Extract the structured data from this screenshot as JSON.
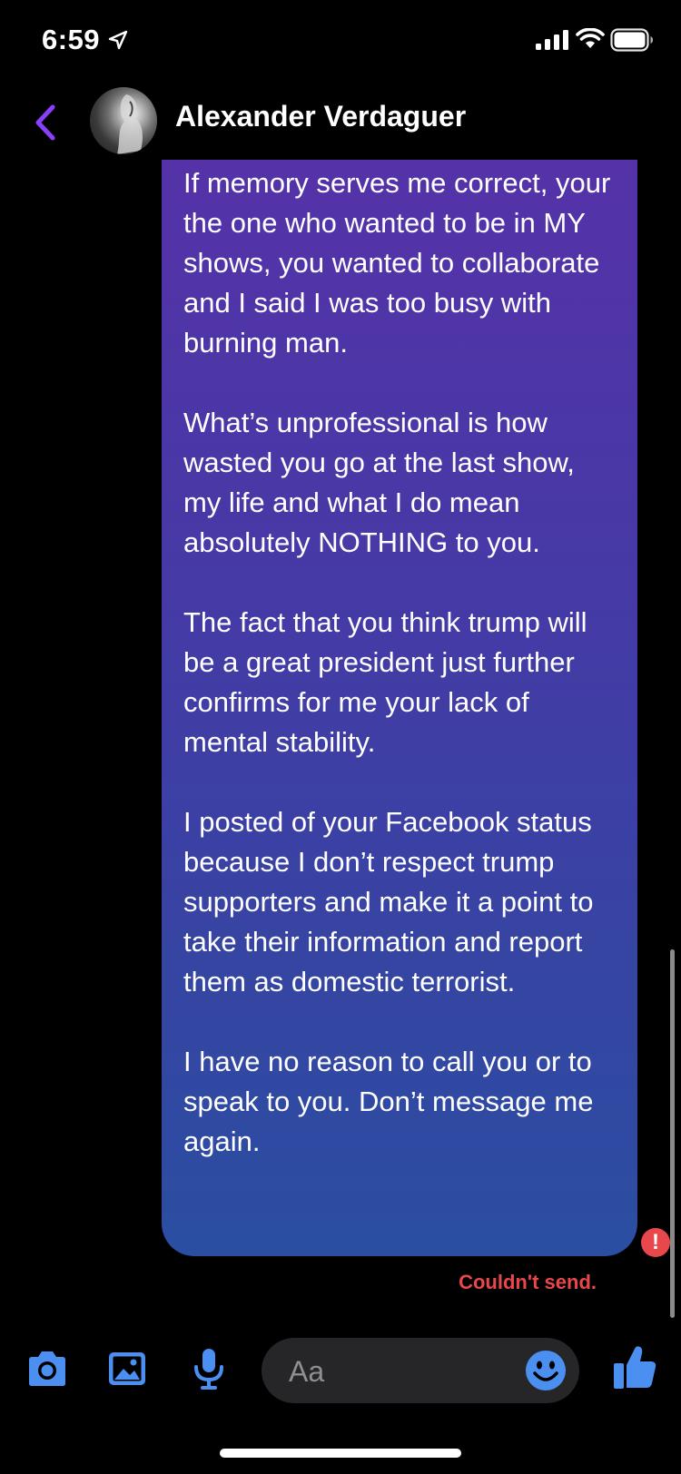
{
  "status_bar": {
    "time": "6:59",
    "icons": [
      "location-arrow-icon",
      "cellular-signal-icon",
      "wifi-icon",
      "battery-icon"
    ]
  },
  "header": {
    "contact_name": "Alexander Verdaguer",
    "back_icon": "chevron-left-icon"
  },
  "message": {
    "paragraphs": [
      "If memory serves me correct, your the one who wanted to be in MY shows, you wanted to collaborate and I said I was too busy with burning man.",
      "What’s unprofessional is how wasted you go at the last show, my life and what I do mean absolutely NOTHING to you.",
      "The fact that you think trump will be a great president just further confirms for me your lack of mental stability.",
      "I posted of your Facebook status because I don’t respect trump supporters and make it a point to take their information and report them as domestic terrorist.",
      "I have no reason to call you or to speak to you. Don’t message me again."
    ],
    "error_mark": "!",
    "status": "Couldn't send."
  },
  "composer": {
    "placeholder": "Aa",
    "tools": [
      "camera-icon",
      "photo-icon",
      "microphone-icon"
    ],
    "emoji_icon": "emoji-icon",
    "like_icon": "thumbs-up-icon"
  },
  "colors": {
    "accent": "#8a3ffc",
    "messenger_blue": "#4b8ff0",
    "error": "#e8474c",
    "bubble_top": "#5532a8",
    "bubble_bottom": "#2a4ea2"
  }
}
